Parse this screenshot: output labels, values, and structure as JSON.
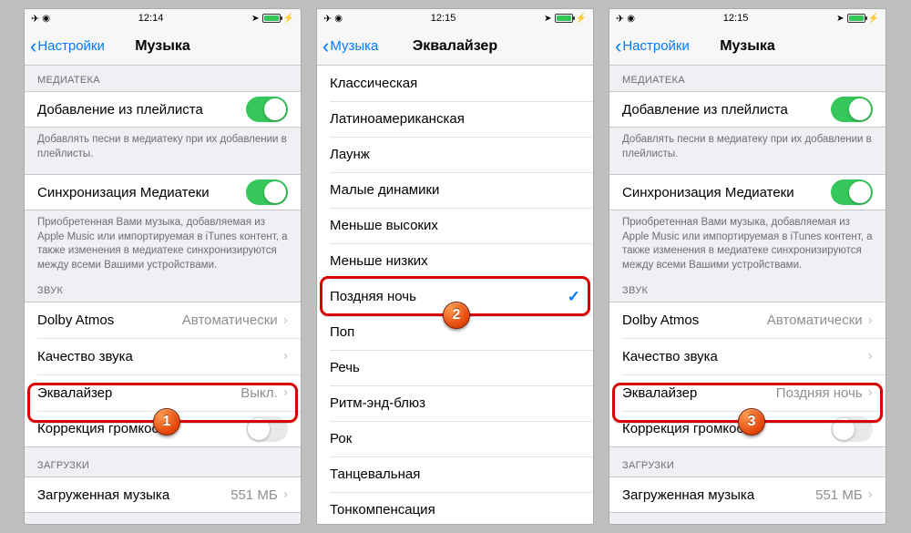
{
  "panels": [
    {
      "status": {
        "time": "12:14"
      },
      "nav": {
        "back": "Настройки",
        "title": "Музыка"
      },
      "sec_library": "МЕДИАТЕКА",
      "row_playlist": "Добавление из плейлиста",
      "note_playlist": "Добавлять песни в медиатеку при их добавлении в плейлисты.",
      "row_sync": "Синхронизация Медиатеки",
      "note_sync": "Приобретенная Вами музыка, добавляемая из Apple Music или импортируемая в iTunes контент, а также изменения в медиатеке синхронизируются между всеми Вашими устройствами.",
      "sec_sound": "ЗВУК",
      "row_dolby": {
        "label": "Dolby Atmos",
        "value": "Автоматически"
      },
      "row_quality": "Качество звука",
      "row_eq": {
        "label": "Эквалайзер",
        "value": "Выкл."
      },
      "row_loud": "Коррекция громкости",
      "sec_downloads": "ЗАГРУЗКИ",
      "row_downloaded": {
        "label": "Загруженная музыка",
        "value": "551 МБ"
      }
    },
    {
      "status": {
        "time": "12:15"
      },
      "nav": {
        "back": "Музыка",
        "title": "Эквалайзер"
      },
      "items": [
        "Классическая",
        "Латиноамериканская",
        "Лаунж",
        "Малые динамики",
        "Меньше высоких",
        "Меньше низких",
        "Поздняя ночь",
        "Поп",
        "Речь",
        "Ритм-энд-блюз",
        "Рок",
        "Танцевальная",
        "Тонкомпенсация"
      ],
      "selected_index": 6
    },
    {
      "status": {
        "time": "12:15"
      },
      "nav": {
        "back": "Настройки",
        "title": "Музыка"
      },
      "sec_library": "МЕДИАТЕКА",
      "row_playlist": "Добавление из плейлиста",
      "note_playlist": "Добавлять песни в медиатеку при их добавлении в плейлисты.",
      "row_sync": "Синхронизация Медиатеки",
      "note_sync": "Приобретенная Вами музыка, добавляемая из Apple Music или импортируемая в iTunes контент, а также изменения в медиатеке синхронизируются между всеми Вашими устройствами.",
      "sec_sound": "ЗВУК",
      "row_dolby": {
        "label": "Dolby Atmos",
        "value": "Автоматически"
      },
      "row_quality": "Качество звука",
      "row_eq": {
        "label": "Эквалайзер",
        "value": "Поздняя ночь"
      },
      "row_loud": "Коррекция громкости",
      "sec_downloads": "ЗАГРУЗКИ",
      "row_downloaded": {
        "label": "Загруженная музыка",
        "value": "551 МБ"
      }
    }
  ],
  "badges": [
    "1",
    "2",
    "3"
  ]
}
